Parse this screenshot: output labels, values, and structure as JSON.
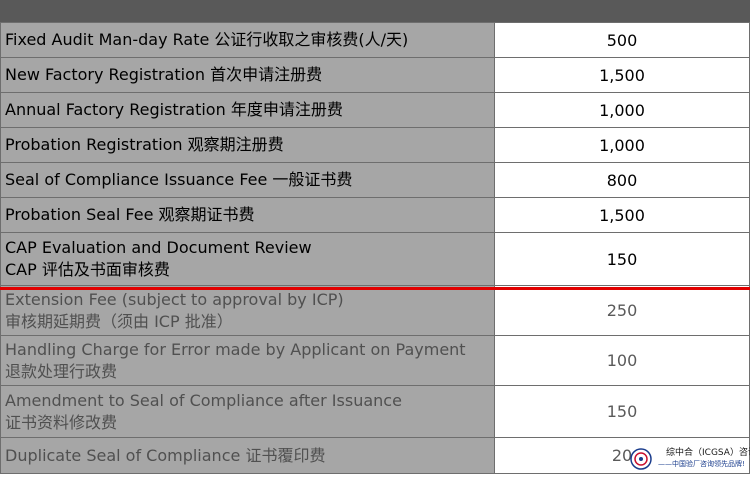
{
  "fees": [
    {
      "en": "Fixed Audit Man-day Rate",
      "zh": "公证行收取之审核费(人/天)",
      "value": "500",
      "two_line": false,
      "faded": false
    },
    {
      "en": "New Factory Registration",
      "zh": "首次申请注册费",
      "value": "1,500",
      "two_line": false,
      "faded": false
    },
    {
      "en": "Annual Factory Registration",
      "zh": "年度申请注册费",
      "value": "1,000",
      "two_line": false,
      "faded": false
    },
    {
      "en": "Probation Registration",
      "zh": "观察期注册费",
      "value": "1,000",
      "two_line": false,
      "faded": false
    },
    {
      "en": "Seal of Compliance Issuance Fee",
      "zh": "一般证书费",
      "value": "800",
      "two_line": false,
      "faded": false
    },
    {
      "en": "Probation Seal Fee",
      "zh": "观察期证书费",
      "value": "1,500",
      "two_line": false,
      "faded": false
    },
    {
      "en": "CAP Evaluation and Document Review",
      "zh": "CAP 评估及书面审核费",
      "value": "150",
      "two_line": true,
      "faded": false
    },
    {
      "en": "Extension Fee (subject to approval by ICP)",
      "zh": "审核期延期费（须由 ICP 批准）",
      "value": "250",
      "two_line": true,
      "faded": true
    },
    {
      "en": "Handling Charge for Error made by Applicant on Payment",
      "zh": "退款处理行政费",
      "value": "100",
      "two_line": true,
      "faded": true
    },
    {
      "en": "Amendment to Seal of Compliance after Issuance",
      "zh": "证书资料修改费",
      "value": "150",
      "two_line": true,
      "faded": true
    },
    {
      "en": "Duplicate Seal of Compliance",
      "zh": "证书覆印费",
      "value": "20",
      "two_line": false,
      "faded": true
    }
  ],
  "watermark": {
    "title": "综中合（ICGSA）咨询",
    "slogan": "——中国验厂咨询领先品牌!"
  },
  "colors": {
    "header": "#595959",
    "label_bg": "#a6a6a6",
    "divider": "#e10000"
  }
}
